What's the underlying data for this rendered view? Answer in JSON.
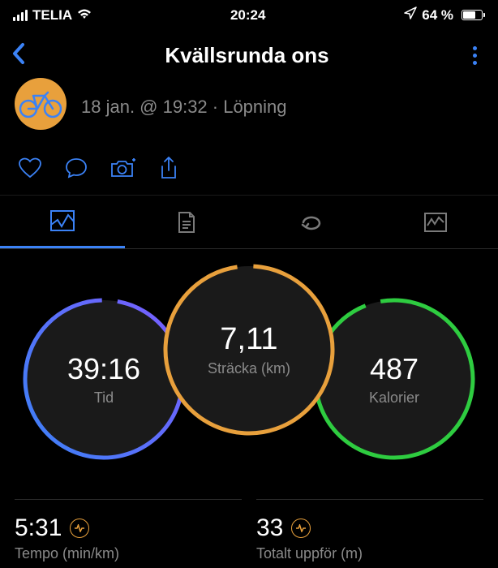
{
  "status": {
    "carrier": "TELIA",
    "time": "20:24",
    "battery_pct": "64 %"
  },
  "header": {
    "title": "Kvällsrunda ons",
    "subtitle": "18 jan. @ 19:32 · Löpning"
  },
  "metrics": {
    "distance": {
      "value": "7,11",
      "label": "Sträcka (km)"
    },
    "time": {
      "value": "39:16",
      "label": "Tid"
    },
    "calories": {
      "value": "487",
      "label": "Kalorier"
    }
  },
  "stats": {
    "pace": {
      "value": "5:31",
      "label": "Tempo (min/km)"
    },
    "ascent": {
      "value": "33",
      "label": "Totalt uppför (m)"
    }
  },
  "colors": {
    "accent": "#3b82f6",
    "distance_ring": "#e8a03c",
    "time_ring_a": "#3b82f6",
    "time_ring_b": "#7b5cff",
    "calories_ring": "#2ecc40"
  }
}
